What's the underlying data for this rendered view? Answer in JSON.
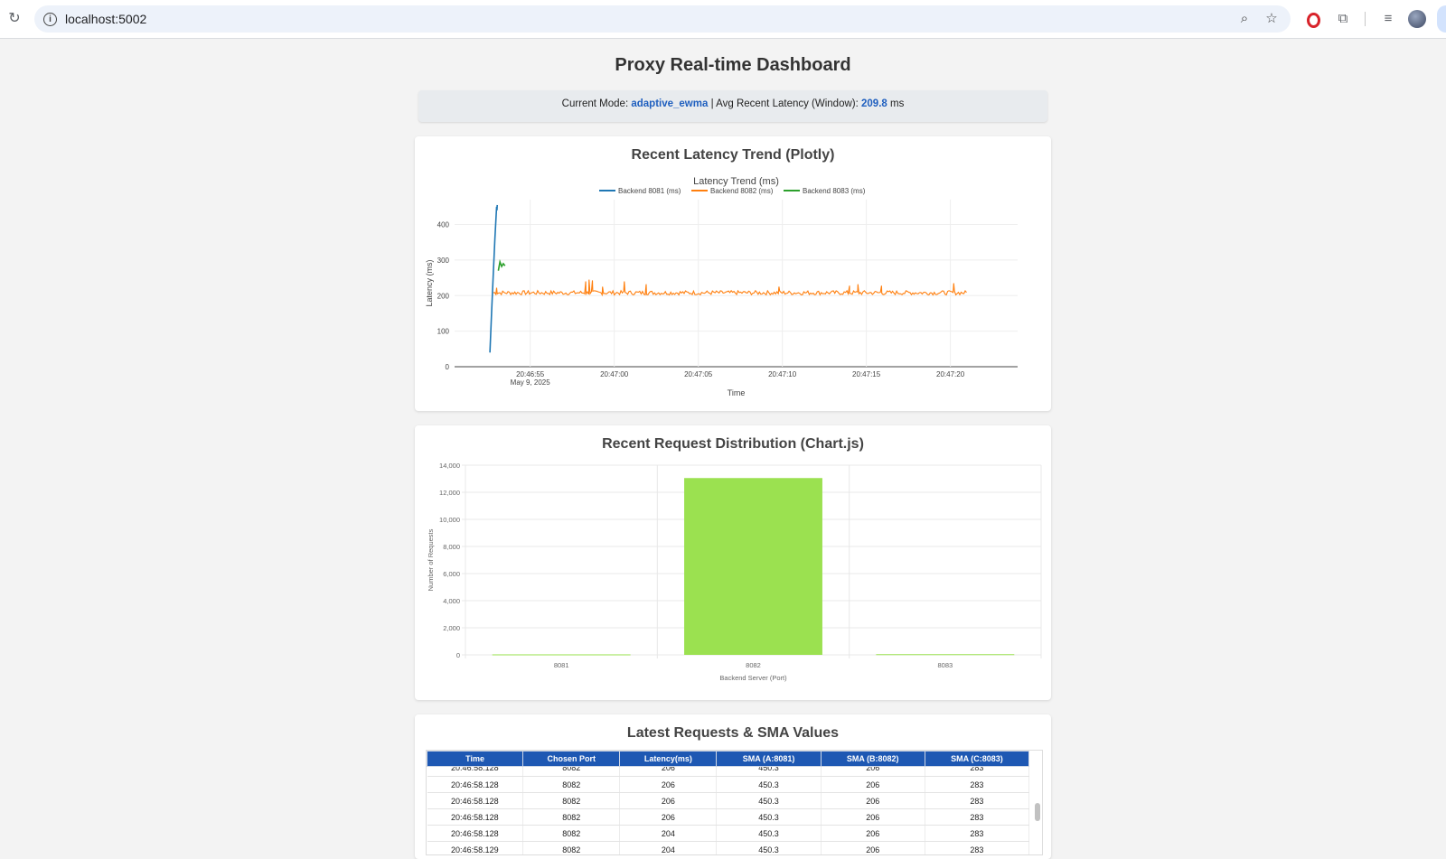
{
  "browser": {
    "url": "localhost:5002"
  },
  "page_title": "Proxy Real-time Dashboard",
  "status": {
    "mode_label": "Current Mode:",
    "mode_value": "adaptive_ewma",
    "separator": "|",
    "latency_label": "Avg Recent Latency (Window):",
    "latency_value": "209.8",
    "latency_unit": "ms"
  },
  "latency_card": {
    "heading": "Recent Latency Trend (Plotly)"
  },
  "distribution_card": {
    "heading": "Recent Request Distribution (Chart.js)"
  },
  "table_card": {
    "heading": "Latest Requests & SMA Values",
    "columns": [
      "Time",
      "Chosen Port",
      "Latency(ms)",
      "SMA (A:8081)",
      "SMA (B:8082)",
      "SMA (C:8083)"
    ],
    "clipped_row": [
      "20:46:58.128",
      "8082",
      "206",
      "450.3",
      "206",
      "283"
    ],
    "rows": [
      [
        "20:46:58.128",
        "8082",
        "206",
        "450.3",
        "206",
        "283"
      ],
      [
        "20:46:58.128",
        "8082",
        "206",
        "450.3",
        "206",
        "283"
      ],
      [
        "20:46:58.128",
        "8082",
        "206",
        "450.3",
        "206",
        "283"
      ],
      [
        "20:46:58.128",
        "8082",
        "204",
        "450.3",
        "206",
        "283"
      ],
      [
        "20:46:58.129",
        "8082",
        "204",
        "450.3",
        "206",
        "283"
      ]
    ]
  },
  "chart_data": [
    {
      "type": "line",
      "title": "Latency Trend (ms)",
      "xlabel": "Time",
      "ylabel": "Latency (ms)",
      "ylim": [
        0,
        470
      ],
      "xlim": [
        "20:46:50.5",
        "20:47:24"
      ],
      "x_tick_labels": [
        "20:46:55",
        "20:47:00",
        "20:47:05",
        "20:47:10",
        "20:47:15",
        "20:47:20"
      ],
      "x_tick_date": "May 9, 2025",
      "y_ticks": [
        0,
        100,
        200,
        300,
        400
      ],
      "grid": true,
      "legend_position": "top",
      "series": [
        {
          "name": "Backend 8081 (ms)",
          "color": "#1f77b4",
          "points": [
            [
              "20:46:52.6",
              40
            ],
            [
              "20:46:52.7",
              150
            ],
            [
              "20:46:52.8",
              260
            ],
            [
              "20:46:52.9",
              360
            ],
            [
              "20:46:53.0",
              450
            ],
            [
              "20:46:53.02",
              440
            ],
            [
              "20:46:53.04",
              455
            ]
          ]
        },
        {
          "name": "Backend 8082 (ms)",
          "color": "#ff7f0e",
          "summary": "approximately 200–215 ms throughout with occasional spikes near 245 ms",
          "start": "20:46:52.8",
          "end": "20:47:21.0",
          "baseline": 208,
          "spikes": [
            [
              "20:46:53.0",
              222
            ],
            [
              "20:46:58.3",
              240
            ],
            [
              "20:46:58.5",
              245
            ],
            [
              "20:46:58.7",
              243
            ],
            [
              "20:46:59.3",
              225
            ],
            [
              "20:47:00.6",
              240
            ],
            [
              "20:47:01.9",
              232
            ],
            [
              "20:47:09.8",
              225
            ],
            [
              "20:47:14.0",
              228
            ],
            [
              "20:47:14.5",
              232
            ],
            [
              "20:47:15.9",
              228
            ],
            [
              "20:47:20.2",
              235
            ]
          ]
        },
        {
          "name": "Backend 8083 (ms)",
          "color": "#2ca02c",
          "points": [
            [
              "20:46:53.1",
              270
            ],
            [
              "20:46:53.2",
              295
            ],
            [
              "20:46:53.3",
              282
            ],
            [
              "20:46:53.4",
              290
            ],
            [
              "20:46:53.5",
              284
            ]
          ]
        }
      ]
    },
    {
      "type": "bar",
      "categories": [
        "8081",
        "8082",
        "8083"
      ],
      "values": [
        35,
        13050,
        50
      ],
      "color": "#9be150",
      "xlabel": "Backend Server (Port)",
      "ylabel": "Number of Requests",
      "ylim": [
        0,
        14000
      ],
      "y_ticks": [
        "0",
        "2,000",
        "4,000",
        "6,000",
        "8,000",
        "10,000",
        "12,000",
        "14,000"
      ],
      "grid": true
    }
  ]
}
